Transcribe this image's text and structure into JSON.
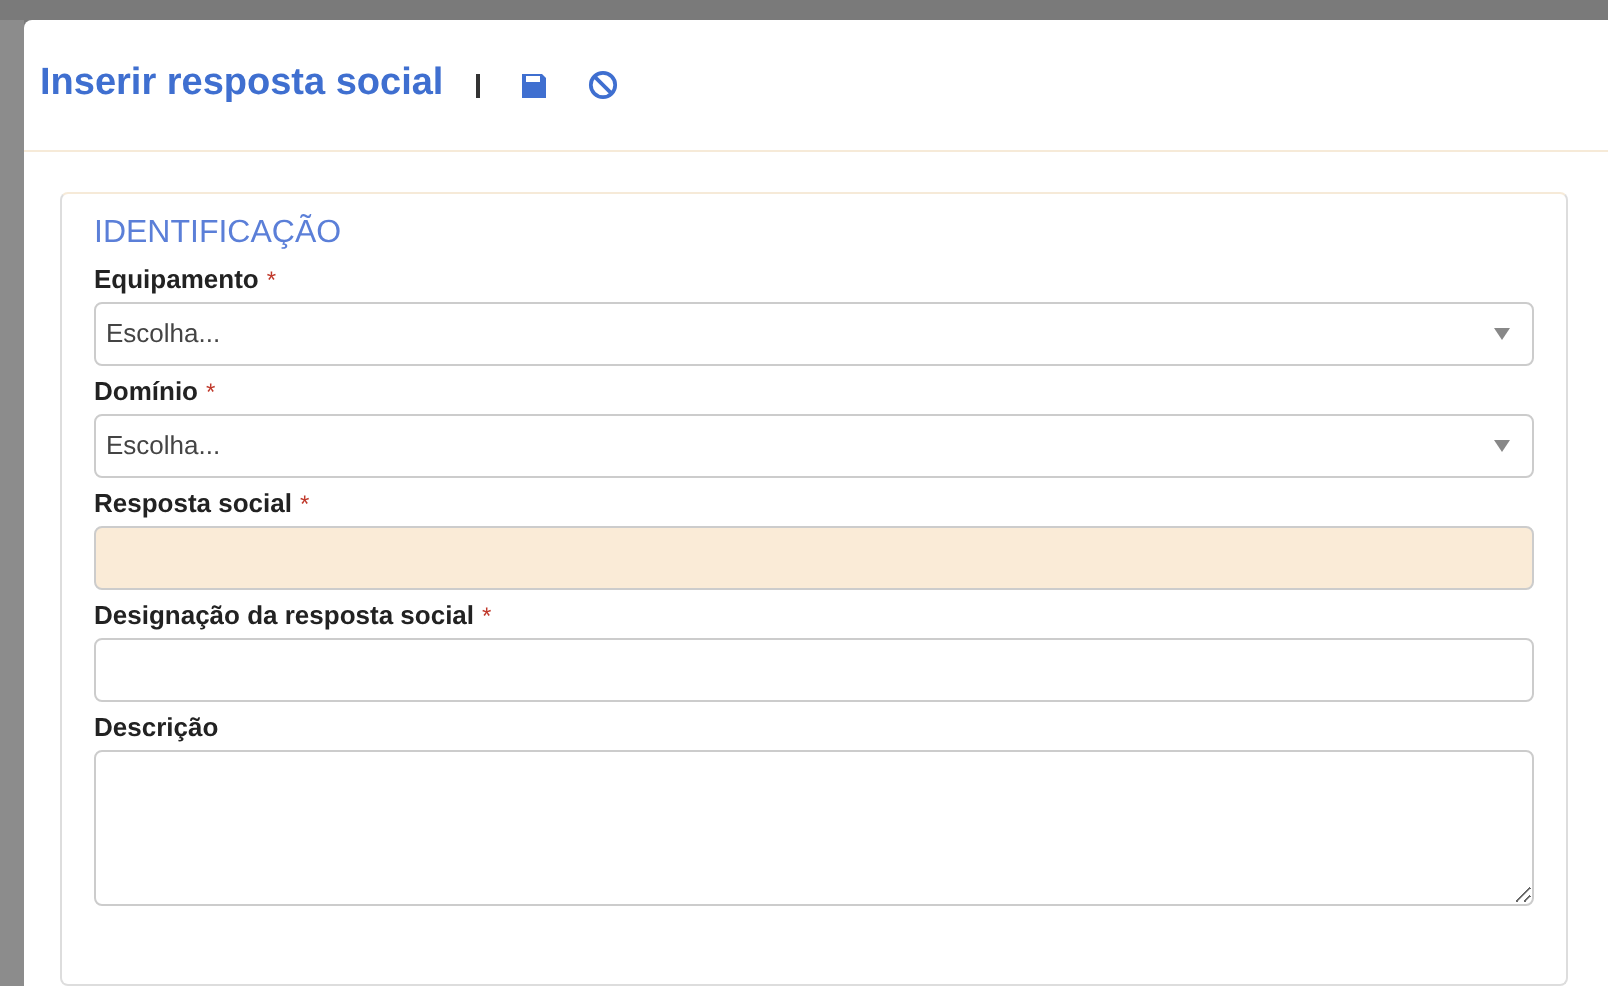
{
  "dialog": {
    "title": "Inserir resposta social"
  },
  "section": {
    "title": "IDENTIFICAÇÃO"
  },
  "fields": [
    {
      "kind": "select",
      "label": "Equipamento",
      "required_mark": "*",
      "value": "Escolha..."
    },
    {
      "kind": "select",
      "label": "Domínio",
      "required_mark": "*",
      "value": "Escolha..."
    },
    {
      "kind": "text",
      "label": "Resposta social",
      "required_mark": "*",
      "disabled": true
    },
    {
      "kind": "text",
      "label": "Designação da resposta social",
      "required_mark": "*",
      "disabled": false
    },
    {
      "kind": "textarea",
      "label": "Descrição",
      "disabled": false
    }
  ]
}
